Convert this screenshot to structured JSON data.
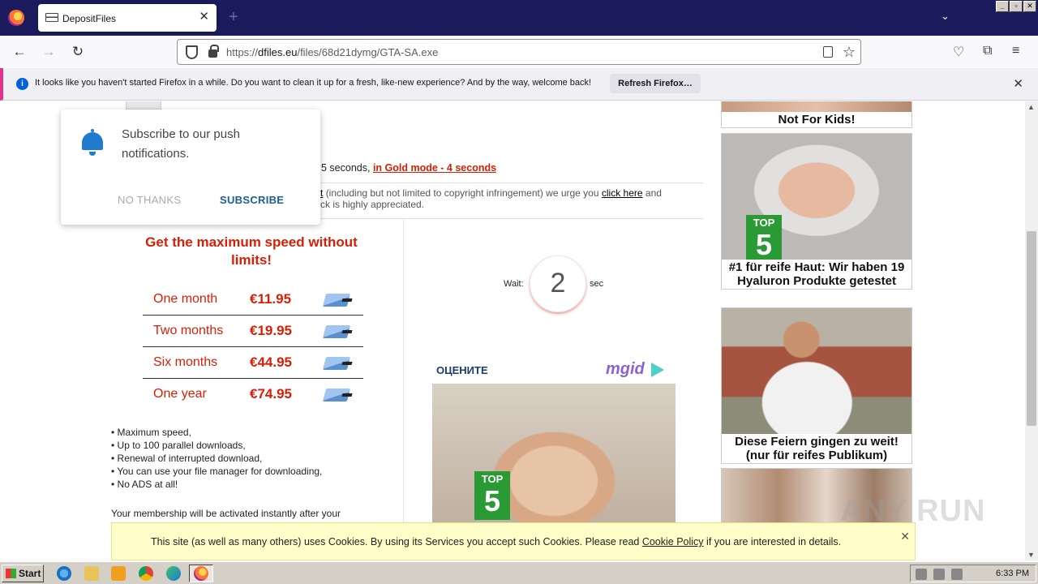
{
  "browser": {
    "tab_title": "DepositFiles",
    "tab_close": "✕",
    "new_tab": "+",
    "tablist": "⌄",
    "url_scheme": "https://",
    "url_host": "dfiles.eu",
    "url_path": "/files/68d21dymg/GTA-SA.exe",
    "win_min": "_",
    "win_max": "▫",
    "win_close": "✕"
  },
  "notification_bar": {
    "message": "It looks like you haven't started Firefox in a while. Do you want to clean it up for a fresh, like-new experience? And by the way, welcome back!",
    "button": "Refresh Firefox…",
    "close": "✕"
  },
  "push_popup": {
    "message": "Subscribe to our push notifications.",
    "no_thanks": "NO THANKS",
    "subscribe": "SUBSCRIBE"
  },
  "download": {
    "speed_prefix": "5 seconds,",
    "gold_link": "in Gold mode - 4 seconds",
    "abuse_link_fragment": "t",
    "abuse_text1": "(including but not limited to copyright infringement) we urge you",
    "abuse_link": "click here",
    "abuse_text2": "and",
    "abuse_text3": "ck is highly appreciated."
  },
  "premium": {
    "headline": "Get the maximum speed without limits!",
    "plans": [
      {
        "period": "One month",
        "price": "€11.95"
      },
      {
        "period": "Two months",
        "price": "€19.95"
      },
      {
        "period": "Six months",
        "price": "€44.95"
      },
      {
        "period": "One year",
        "price": "€74.95"
      }
    ],
    "features": [
      "Maximum speed,",
      "Up to 100 parallel downloads,",
      "Renewal of interrupted download,",
      "You can use your file manager for downloading,",
      "No ADS at all!"
    ],
    "membership_note": "Your membership will be activated instantly after your"
  },
  "wait": {
    "label": "Wait:",
    "value": "2",
    "unit": "sec"
  },
  "ad_widget": {
    "heading": "ОЦЕНИТЕ",
    "brand": "mgid",
    "top5_label": "TOP",
    "top5_number": "5"
  },
  "sidebar_ads": [
    {
      "caption": "Not For Kids!"
    },
    {
      "caption": "#1 für reife Haut: Wir haben 19 Hyaluron Produkte getestet",
      "top5_label": "TOP",
      "top5_number": "5"
    },
    {
      "caption": "Diese Feiern gingen zu weit! (nur für reifes Publikum)"
    },
    {
      "caption": ""
    }
  ],
  "cookie_banner": {
    "text1": "This site (as well as many others) uses Cookies. By using its Services you accept such Cookies. Please read",
    "link": "Cookie Policy",
    "text2": "if you are interested in details.",
    "close": "✕"
  },
  "watermark": "ANY RUN",
  "taskbar": {
    "start": "Start",
    "clock": "6:33 PM"
  },
  "colors": {
    "accent_red": "#d81e05",
    "firefox_titlebar": "#1c1b5e",
    "cookie_bg": "#fffec8",
    "push_blue": "#1e7bd0"
  }
}
